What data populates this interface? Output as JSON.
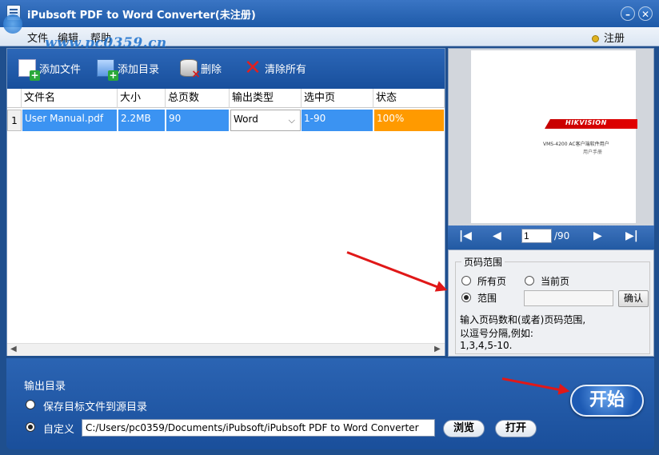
{
  "window": {
    "title": "iPubsoft PDF to Word Converter(未注册)"
  },
  "menu": {
    "file": "文件",
    "edit": "编辑",
    "help": "帮助",
    "register": "注册"
  },
  "watermark": {
    "text": "www.pc0359.cn"
  },
  "toolbar": {
    "add_file": "添加文件",
    "add_folder": "添加目录",
    "delete": "删除",
    "clear_all": "清除所有"
  },
  "table": {
    "headers": [
      "文件名",
      "大小",
      "总页数",
      "输出类型",
      "选中页",
      "状态"
    ],
    "rows": [
      {
        "index": "1",
        "file_name": "User Manual.pdf",
        "size": "2.2MB",
        "pages": "90",
        "output_type": "Word",
        "selected_pages": "1-90",
        "status": "100%"
      }
    ]
  },
  "preview": {
    "brand": "HIKVISION",
    "line1": "VMS-4200 AC客户端软件用户",
    "line2": "用户手册",
    "current_page": "1",
    "total_pages": "/90"
  },
  "range": {
    "legend": "页码范围",
    "all_pages": "所有页",
    "current_page": "当前页",
    "range": "范围",
    "range_value": "",
    "confirm": "确认",
    "hint1": "输入页码数和(或者)页码范围,",
    "hint2": "以逗号分隔,例如:",
    "hint3": "1,3,4,5-10."
  },
  "output": {
    "title": "输出目录",
    "save_to_source": "保存目标文件到源目录",
    "custom": "自定义",
    "path": "C:/Users/pc0359/Documents/iPubsoft/iPubsoft PDF to Word Converter",
    "browse": "浏览",
    "open": "打开",
    "start": "开始"
  },
  "colors": {
    "accent": "#1e5aa8",
    "selected_row": "#3b93f2",
    "status": "#ff9a00",
    "arrow": "#e01818"
  }
}
